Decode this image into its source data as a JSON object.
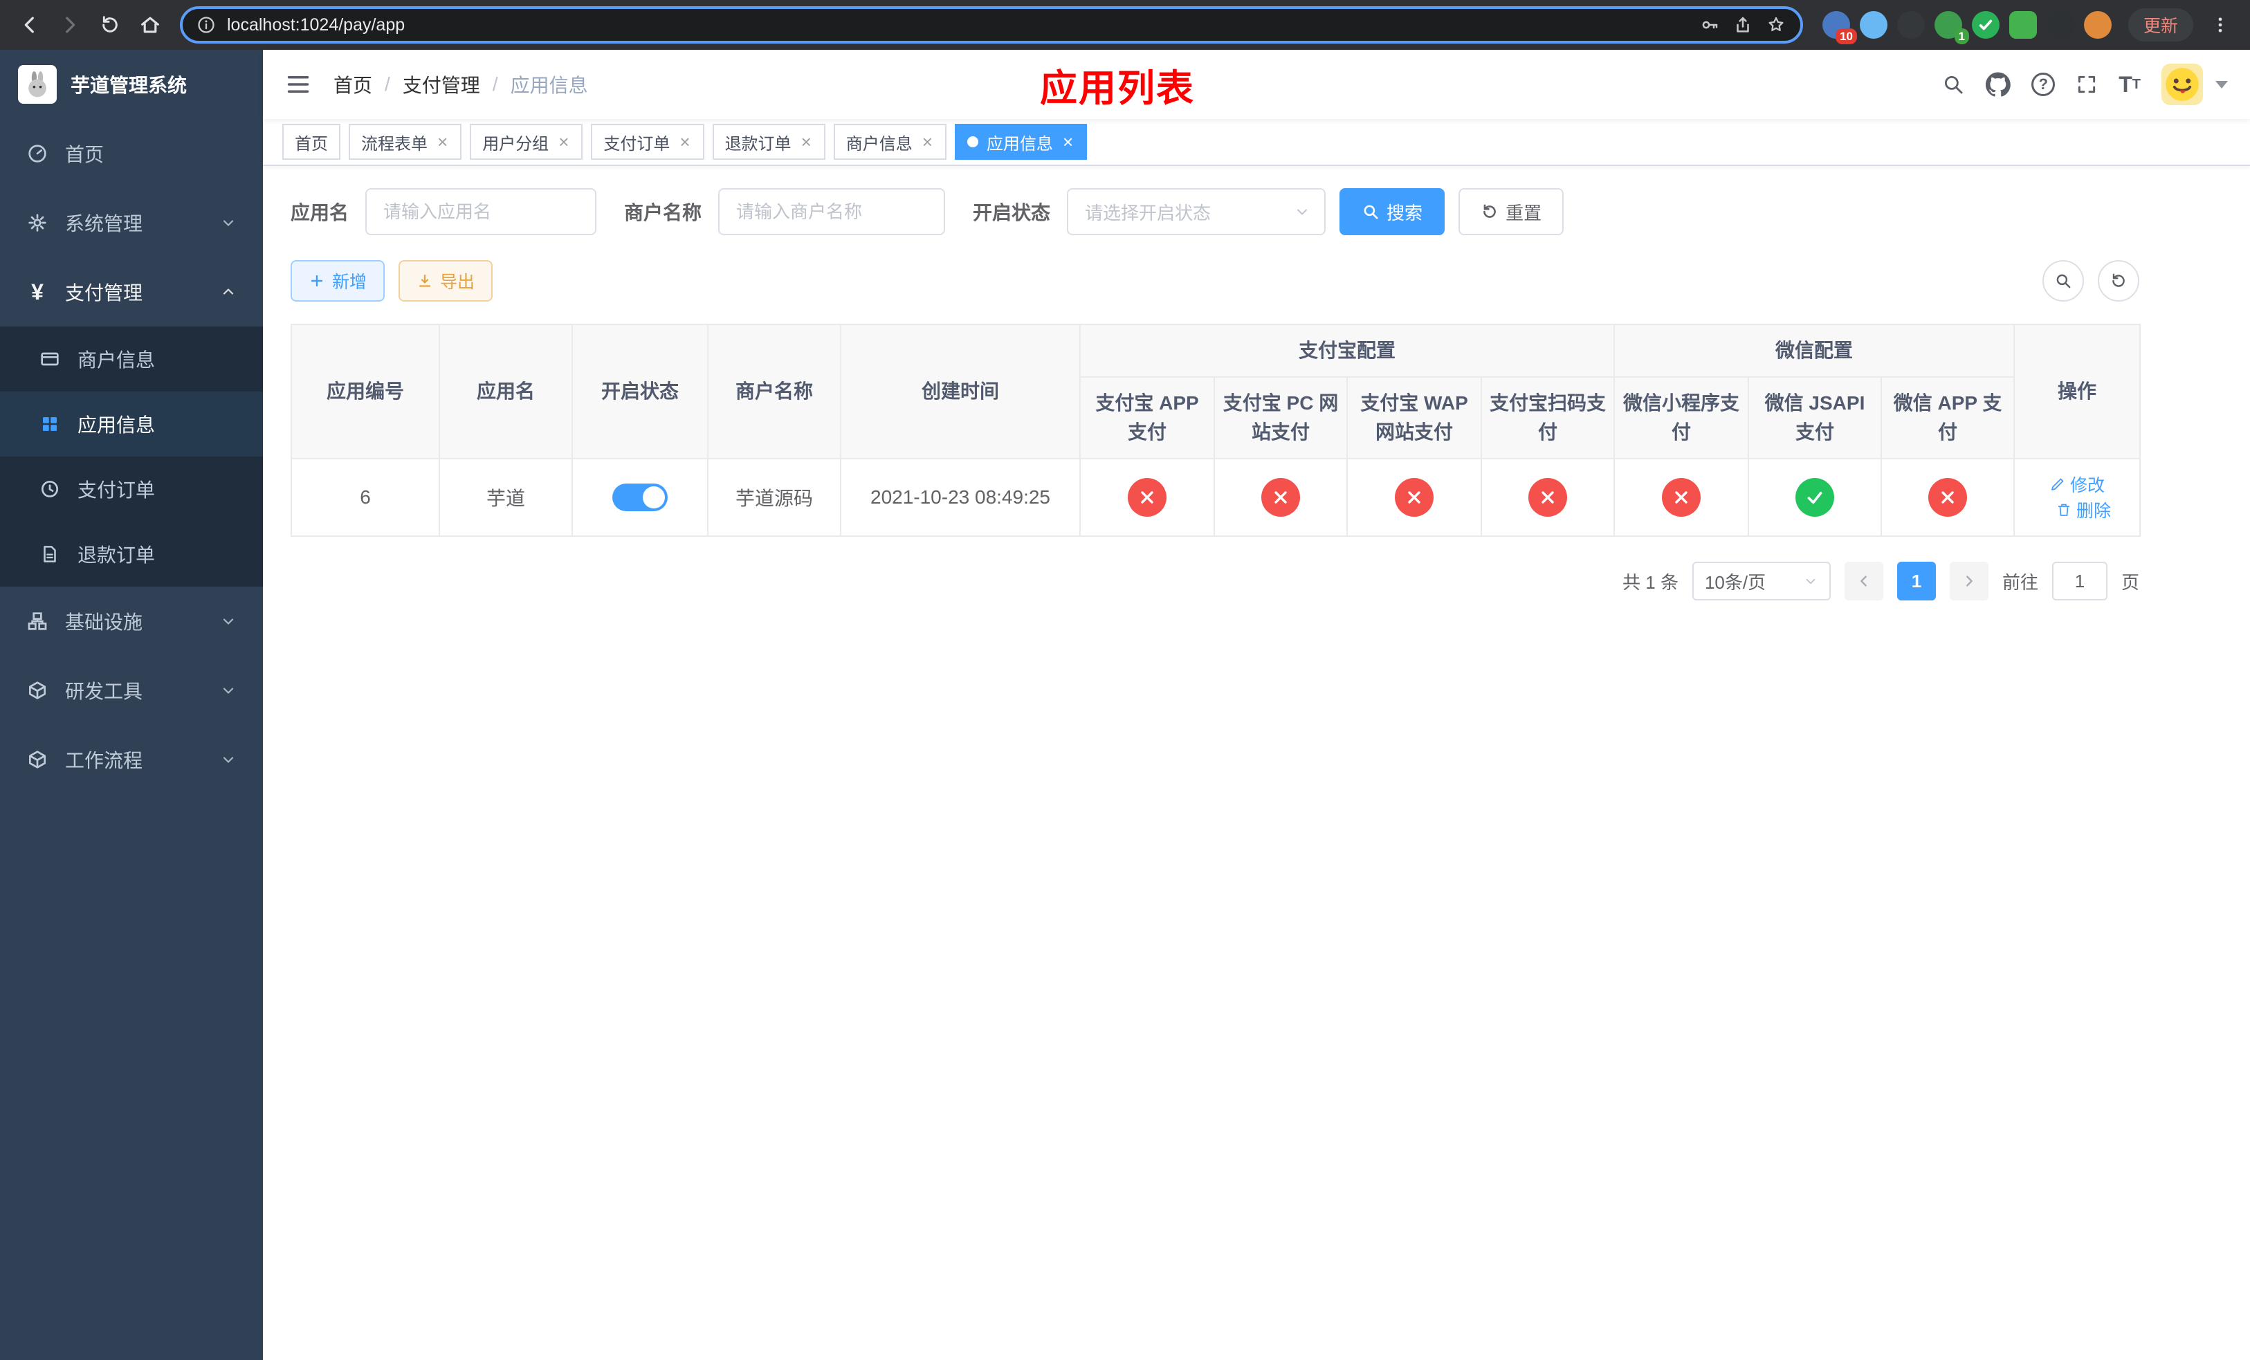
{
  "browser": {
    "url": "localhost:1024/pay/app",
    "update_label": "更新",
    "extension_badge": "10",
    "profile_badge": "1"
  },
  "sidebar": {
    "title": "芋道管理系统",
    "items": [
      {
        "label": "首页"
      },
      {
        "label": "系统管理"
      },
      {
        "label": "支付管理"
      },
      {
        "label": "商户信息"
      },
      {
        "label": "应用信息"
      },
      {
        "label": "支付订单"
      },
      {
        "label": "退款订单"
      },
      {
        "label": "基础设施"
      },
      {
        "label": "研发工具"
      },
      {
        "label": "工作流程"
      }
    ]
  },
  "header": {
    "breadcrumb": [
      "首页",
      "支付管理",
      "应用信息"
    ],
    "separator": "/",
    "title": "应用列表"
  },
  "tabs": [
    {
      "label": "首页"
    },
    {
      "label": "流程表单"
    },
    {
      "label": "用户分组"
    },
    {
      "label": "支付订单"
    },
    {
      "label": "退款订单"
    },
    {
      "label": "商户信息"
    },
    {
      "label": "应用信息"
    }
  ],
  "filters": {
    "app_name_label": "应用名",
    "app_name_placeholder": "请输入应用名",
    "merchant_label": "商户名称",
    "merchant_placeholder": "请输入商户名称",
    "status_label": "开启状态",
    "status_placeholder": "请选择开启状态",
    "search_label": "搜索",
    "reset_label": "重置"
  },
  "toolbar": {
    "add_label": "新增",
    "export_label": "导出"
  },
  "table": {
    "groups": {
      "alipay": "支付宝配置",
      "wechat": "微信配置"
    },
    "columns": {
      "app_id": "应用编号",
      "app_name": "应用名",
      "status": "开启状态",
      "merchant": "商户名称",
      "created": "创建时间",
      "alipay_app": "支付宝 APP 支付",
      "alipay_pc": "支付宝 PC 网站支付",
      "alipay_wap": "支付宝 WAP 网站支付",
      "alipay_qr": "支付宝扫码支付",
      "wx_lite": "微信小程序支付",
      "wx_jsapi": "微信 JSAPI 支付",
      "wx_app": "微信 APP 支付",
      "actions": "操作"
    },
    "rows": [
      {
        "id": "6",
        "name": "芋道",
        "status": true,
        "merchant": "芋道源码",
        "created": "2021-10-23 08:49:25",
        "configs": [
          false,
          false,
          false,
          false,
          false,
          true,
          false
        ],
        "actions": [
          "修改",
          "删除"
        ]
      }
    ]
  },
  "pagination": {
    "total_text": "共 1 条",
    "page_size_text": "10条/页",
    "current_page": "1",
    "goto_prefix": "前往",
    "goto_value": "1",
    "goto_suffix": "页"
  }
}
